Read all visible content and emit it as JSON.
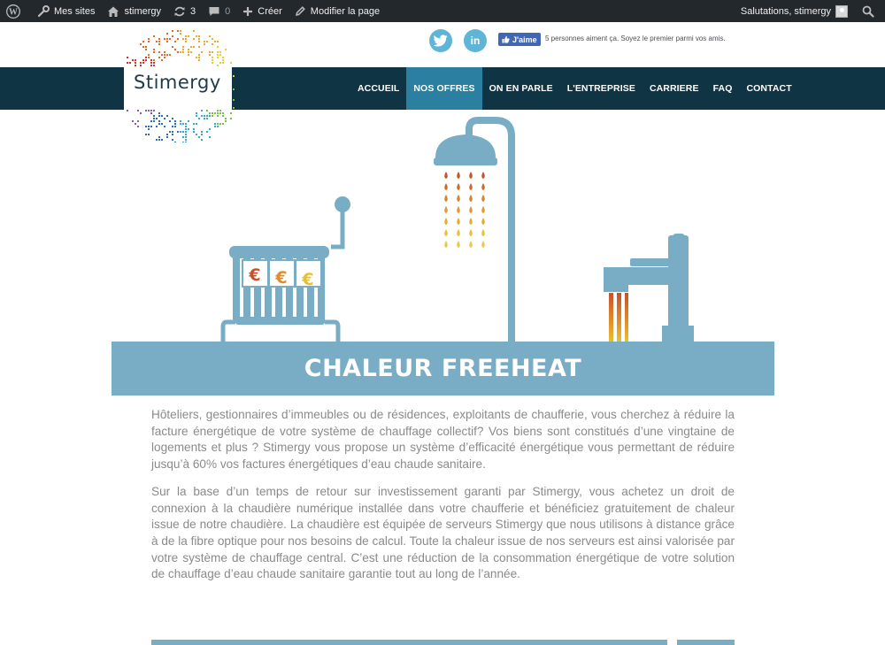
{
  "adminbar": {
    "mes_sites": "Mes sites",
    "site_name": "stimergy",
    "updates_count": "3",
    "comments_count": "0",
    "create": "Créer",
    "edit_page": "Modifier la page",
    "greeting": "Salutations, stimergy"
  },
  "social": {
    "linkedin_label": "in",
    "like_label": "J'aime",
    "like_text": "5 personnes aiment ça. Soyez le premier parmi vos amis."
  },
  "logo": {
    "text": "Stimergy"
  },
  "nav": {
    "items": [
      {
        "label": "ACCUEIL",
        "active": false
      },
      {
        "label": "NOS OFFRES",
        "active": true
      },
      {
        "label": "ON EN PARLE",
        "active": false
      },
      {
        "label": "L'ENTREPRISE",
        "active": false
      },
      {
        "label": "CARRIERE",
        "active": false
      },
      {
        "label": "FAQ",
        "active": false
      },
      {
        "label": "CONTACT",
        "active": false
      }
    ]
  },
  "hero": {
    "radiator_symbols": [
      "€",
      "€",
      "€"
    ],
    "title": "CHALEUR FREEHEAT"
  },
  "content": {
    "paragraphs": [
      "Hôteliers, gestionnaires d’immeubles ou de résidences, exploitants de chaufferie, vous cherchez à réduire la facture énergétique de votre système de chauffage collectif? Vos biens sont constitués d’une vingtaine de logements et plus ? Stimergy vous propose un système d’efficacité énergétique vous permettant de réduire jusqu’à 60% vos factures énergétiques d’eau chaude sanitaire.",
      "Sur la base d’un temps de retour sur investissement garanti par Stimergy, vous achetez un droit de connexion à la chaudière numérique installée dans votre chaufferie et bénéficiez gratuitement de chaleur issue de notre chaudière. La chaudière est équipée de serveurs Stimergy que nous utilisons à distance grâce à de la fibre optique pour nos besoins de calcul. Toute la chaleur issue de nos serveurs est ainsi valorisée par votre système de chauffage central. C’est une réduction de la consommation énergétique de votre solution de chauffage d’eau chaude sanitaire garantie tout au long de l’année."
    ]
  },
  "colors": {
    "adminbar_bg": "#23282d",
    "nav_bg": "#0f3545",
    "nav_active": "#2b7fa0",
    "illustration_blue": "#78adc5",
    "social_blue": "#5fb5d6",
    "text_gray": "#8a8a8a"
  }
}
